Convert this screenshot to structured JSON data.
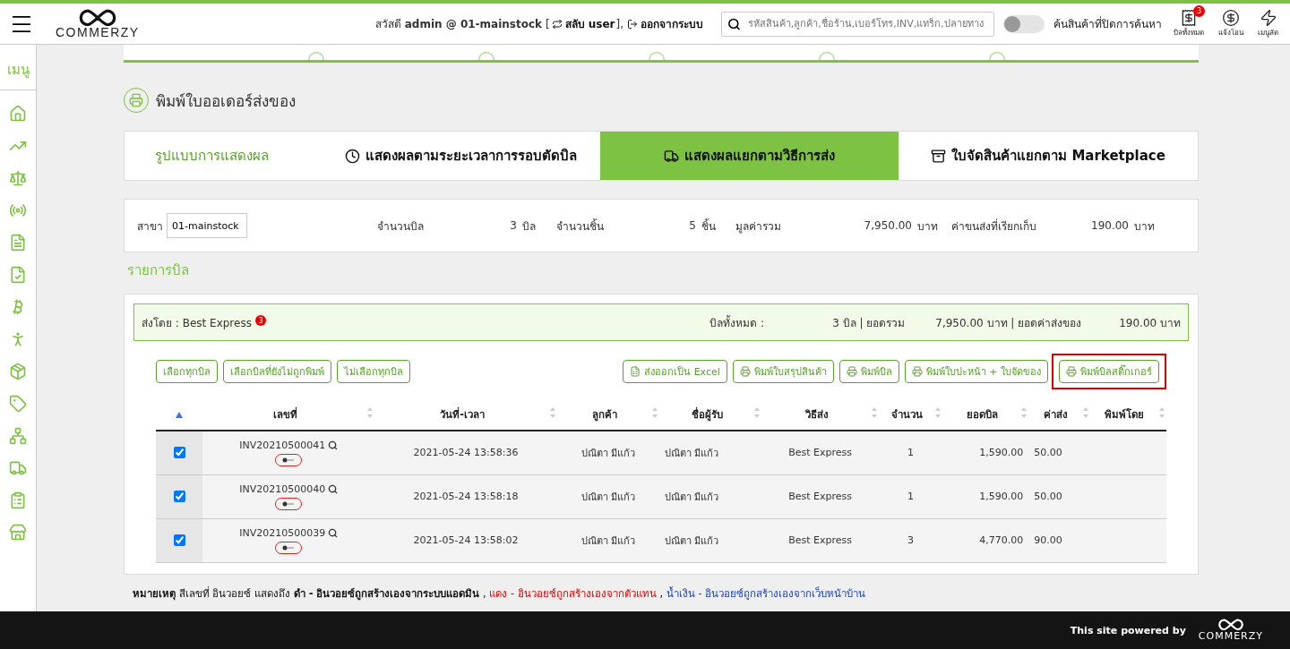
{
  "header": {
    "brand": "COMMERZY",
    "greeting": "สวัสดี **admin @ 01-mainstock** [",
    "switch_user": "สลับ user",
    "bracket_close": "],",
    "logout": "ออกจากระบบ",
    "search": {
      "placeholder": "รหัสสินค้า,ลูกค้า,ชื่อร้าน,เบอร์โทร,INV,แทร็ก,ปลายทาง"
    },
    "hidden_search": {
      "label": "ค้นสินค้าที่ปิดการค้นหา",
      "on": false
    },
    "shortcuts": [
      {
        "kind": "bill",
        "label": "บิลทั้งหมด",
        "badge": "3"
      },
      {
        "kind": "money",
        "label": "แจ้งโอน"
      },
      {
        "kind": "bolt",
        "label": "เมนูลัด"
      }
    ]
  },
  "sidebar": {
    "title": "เมนู"
  },
  "page_title": "พิมพ์ใบออเดอร์ส่งของ",
  "display": {
    "label": "รูปแบบการแสดงผล",
    "tabs": [
      {
        "kind": "clock",
        "label": "แสดงผลตามระยะเวลาการรอบตัดบิล",
        "selected": false
      },
      {
        "kind": "truck",
        "label": "แสดงผลแยกตามวิธีการส่ง",
        "selected": true
      },
      {
        "kind": "box",
        "label": "ใบจัดสินค้าแยกตาม Marketplace",
        "selected": false
      }
    ]
  },
  "summary": {
    "branch_label": "สาขา",
    "branch": "01-mainstock",
    "stats": [
      {
        "label": "จำนวนบิล",
        "value": "3",
        "unit": "บิล"
      },
      {
        "label": "จำนวนชิ้น",
        "value": "5",
        "unit": "ชิ้น"
      },
      {
        "label": "มูลค่ารวม",
        "value": "7,950.00",
        "unit": "บาท"
      },
      {
        "label": "ค่าขนส่งที่เรียกเก็บ",
        "value": "190.00",
        "unit": "บาท"
      }
    ]
  },
  "section_title": "รายการบิล",
  "group": {
    "carrier": "ส่งโดย : Best Express",
    "badge": "3",
    "total_label": "บิลทั้งหมด :",
    "bills": "3 บิล | ยอดรวม",
    "amount": "7,950.00 บาท | ยอดค่าส่งของ",
    "shipping": "190.00 บาท",
    "select_buttons": [
      "เลือกทุกบิล",
      "เลือกบิลที่ยังไม่ถูกพิมพ์",
      "ไม่เลือกทุกบิล"
    ],
    "actions": [
      {
        "kind": "excel",
        "label": "ส่งออกเป็น Excel",
        "highlighted": false
      },
      {
        "kind": "print",
        "label": "พิมพ์ใบสรุปสินค้า",
        "highlighted": false
      },
      {
        "kind": "print",
        "label": "พิมพ์บิล",
        "highlighted": false
      },
      {
        "kind": "print",
        "label": "พิมพ์ใบปะหน้า + ใบจัดของ",
        "highlighted": false
      },
      {
        "kind": "print",
        "label": "พิมพ์บิลสติ๊กเกอร์",
        "highlighted": true
      }
    ],
    "table": {
      "columns": [
        "เลขที่",
        "วันที่-เวลา",
        "ลูกค้า",
        "ชื่อผู้รับ",
        "วิธีส่ง",
        "จำนวน",
        "ยอดบิล",
        "ค่าส่ง",
        "พิมพ์โดย"
      ],
      "rows": [
        {
          "checked": true,
          "cells": [
            "INV20210500041",
            "2021-05-24 13:58:36",
            "ปณิตา มีแก้ว",
            "ปณิตา มีแก้ว",
            "Best Express",
            "1",
            "1,590.00",
            "50.00"
          ]
        },
        {
          "checked": true,
          "cells": [
            "INV20210500040",
            "2021-05-24 13:58:18",
            "ปณิตา มีแก้ว",
            "ปณิตา มีแก้ว",
            "Best Express",
            "1",
            "1,590.00",
            "50.00"
          ]
        },
        {
          "checked": true,
          "cells": [
            "INV20210500039",
            "2021-05-24 13:58:02",
            "ปณิตา มีแก้ว",
            "ปณิตา มีแก้ว",
            "Best Express",
            "3",
            "4,770.00",
            "90.00"
          ]
        }
      ]
    }
  },
  "note": [
    {
      "text": "**หมายเหตุ** สีเลขที่ อินวอยซ์ แสดงถึง **ดำ - อินวอยซ์ถูกสร้างเองจากระบบแอดมิน** , ",
      "kind": "admin"
    },
    {
      "text": "แดง - อินวอยซ์ถูกสร้างเองจากตัวแทน",
      "kind": "agent"
    },
    {
      "text": " , ",
      "kind": "admin"
    },
    {
      "text": "น้ำเงิน - อินวอยซ์ถูกสร้างเองจากเว็บหน้าบ้าน",
      "kind": "web"
    }
  ],
  "footer": {
    "powered": "This site powered by",
    "brand": "COMMERZY"
  }
}
